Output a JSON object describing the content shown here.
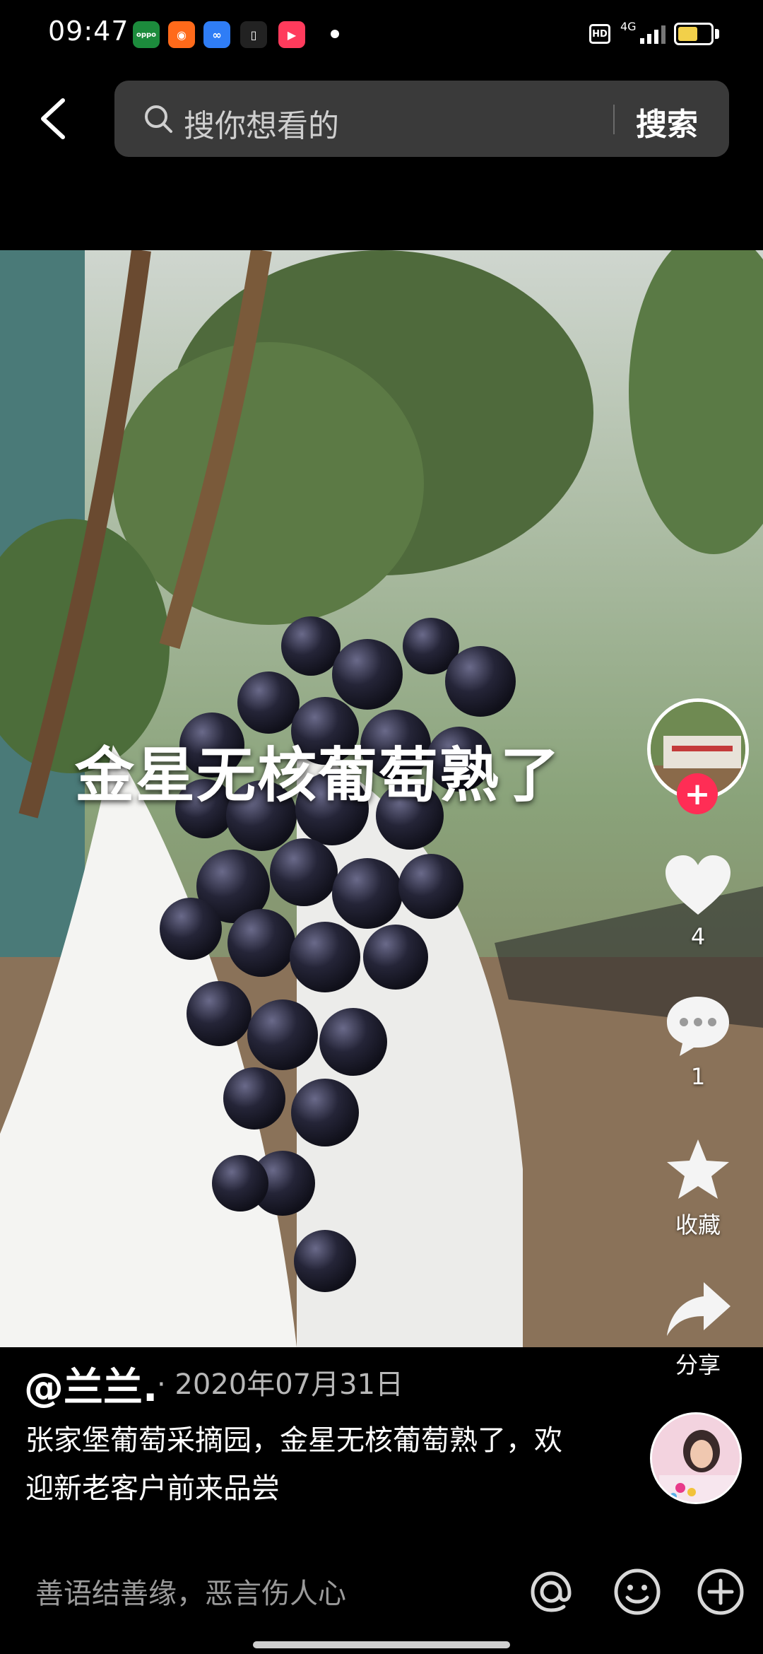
{
  "status_bar": {
    "time": "09:47",
    "hd": "HD",
    "network": "4G",
    "battery_level": 0.62,
    "apps": [
      {
        "name": "oppo-app-icon",
        "color": "#1c8b3c",
        "glyph": "oppo"
      },
      {
        "name": "kuaishou-app-icon",
        "color": "#ff6a1a",
        "glyph": "◉"
      },
      {
        "name": "infinity-app-icon",
        "color": "#2f7df6",
        "glyph": "∞"
      },
      {
        "name": "phone-app-icon",
        "color": "#222222",
        "glyph": "▯"
      },
      {
        "name": "video-app-icon",
        "color": "#ff3b5c",
        "glyph": "▶"
      }
    ]
  },
  "top_bar": {
    "search_placeholder": "搜你想看的",
    "search_button": "搜索"
  },
  "video": {
    "caption": "金星无核葡萄熟了"
  },
  "actions": {
    "like_count": "4",
    "comment_count": "1",
    "favorite_label": "收藏",
    "share_label": "分享"
  },
  "post": {
    "username": "@兰兰.",
    "date": "· 2020年07月31日",
    "description": "张家堡葡萄采摘园，金星无核葡萄熟了，欢迎新老客户前来品尝"
  },
  "comment_bar": {
    "placeholder": "善语结善缘，恶言伤人心"
  },
  "colors": {
    "accent": "#ff2d55",
    "battery": "#f2d04a",
    "search_bg": "#3a3a3a"
  }
}
